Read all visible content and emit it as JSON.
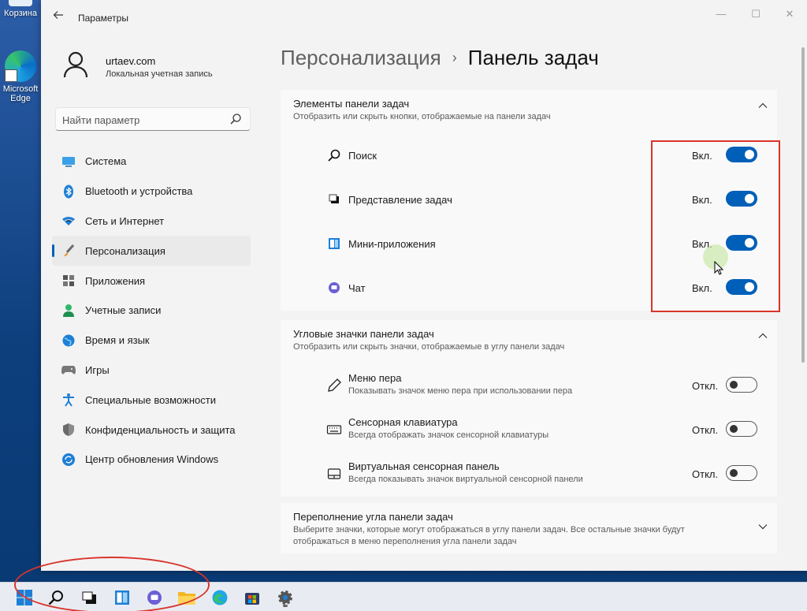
{
  "desktop": {
    "icons": [
      {
        "label": "Корзина"
      },
      {
        "label": "Microsoft Edge"
      }
    ]
  },
  "window": {
    "title": "Параметры",
    "controls": {
      "minimize": "—",
      "maximize": "☐",
      "close": "✕"
    }
  },
  "account": {
    "name": "urtaev.com",
    "type": "Локальная учетная запись"
  },
  "search": {
    "placeholder": "Найти параметр"
  },
  "nav": [
    {
      "label": "Система",
      "icon": "monitor-icon",
      "color": "#0078d4"
    },
    {
      "label": "Bluetooth и устройства",
      "icon": "bluetooth-icon",
      "color": "#0078d4"
    },
    {
      "label": "Сеть и Интернет",
      "icon": "wifi-icon",
      "color": "#0078d4"
    },
    {
      "label": "Персонализация",
      "icon": "brush-icon",
      "color": "#e8912d",
      "active": true
    },
    {
      "label": "Приложения",
      "icon": "apps-icon",
      "color": "#555555"
    },
    {
      "label": "Учетные записи",
      "icon": "person-icon",
      "color": "#2fb86a"
    },
    {
      "label": "Время и язык",
      "icon": "globe-icon",
      "color": "#0078d4"
    },
    {
      "label": "Игры",
      "icon": "gamepad-icon",
      "color": "#666666"
    },
    {
      "label": "Специальные возможности",
      "icon": "accessibility-icon",
      "color": "#0078d4"
    },
    {
      "label": "Конфиденциальность и защита",
      "icon": "shield-icon",
      "color": "#777777"
    },
    {
      "label": "Центр обновления Windows",
      "icon": "update-icon",
      "color": "#0078d4"
    }
  ],
  "breadcrumb": {
    "parent": "Персонализация",
    "separator": "›",
    "current": "Панель задач"
  },
  "sections": {
    "taskbar_items": {
      "title": "Элементы панели задач",
      "description": "Отобразить или скрыть кнопки, отображаемые на панели задач",
      "rows": [
        {
          "label": "Поиск",
          "state": "Вкл.",
          "on": true,
          "icon": "search-icon"
        },
        {
          "label": "Представление задач",
          "state": "Вкл.",
          "on": true,
          "icon": "task-view-icon"
        },
        {
          "label": "Мини-приложения",
          "state": "Вкл.",
          "on": true,
          "icon": "widgets-icon"
        },
        {
          "label": "Чат",
          "state": "Вкл.",
          "on": true,
          "icon": "chat-icon"
        }
      ]
    },
    "corner_icons": {
      "title": "Угловые значки панели задач",
      "description": "Отобразить или скрыть значки, отображаемые в углу панели задач",
      "rows": [
        {
          "label": "Меню пера",
          "sub": "Показывать значок меню пера при использовании пера",
          "state": "Откл.",
          "on": false,
          "icon": "pen-icon"
        },
        {
          "label": "Сенсорная клавиатура",
          "sub": "Всегда отображать значок сенсорной клавиатуры",
          "state": "Откл.",
          "on": false,
          "icon": "keyboard-icon"
        },
        {
          "label": "Виртуальная сенсорная панель",
          "sub": "Всегда показывать значок виртуальной сенсорной панели",
          "state": "Откл.",
          "on": false,
          "icon": "touchpad-icon"
        }
      ]
    },
    "overflow": {
      "title": "Переполнение угла панели задач",
      "description": "Выберите значки, которые могут отображаться в углу панели задач. Все остальные значки будут отображаться в меню переполнения угла панели задач"
    }
  },
  "taskbar": {
    "items": [
      "start-icon",
      "search-icon",
      "task-view-icon",
      "widgets-icon",
      "chat-icon",
      "file-explorer-icon",
      "edge-icon",
      "store-icon",
      "settings-icon"
    ]
  },
  "colors": {
    "accent": "#005fb8",
    "annotation": "#d9342b"
  }
}
